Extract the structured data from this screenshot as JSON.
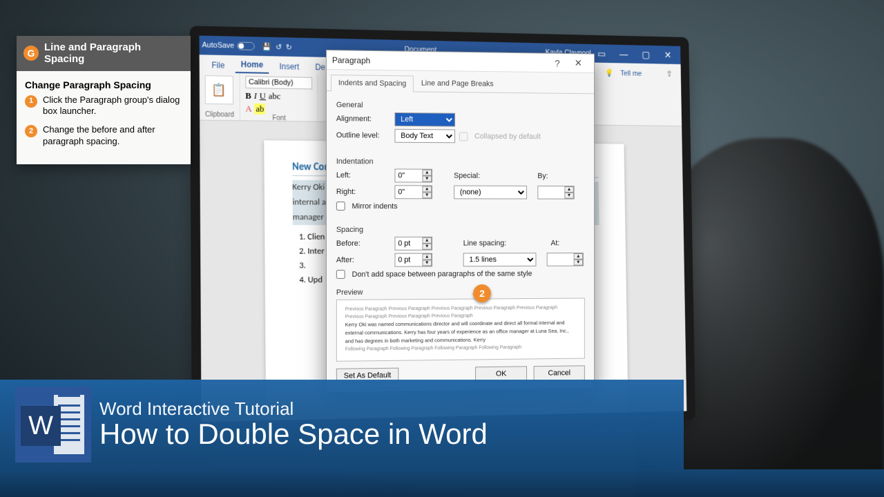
{
  "sidebar": {
    "title": "Line and Paragraph Spacing",
    "icon_letter": "G",
    "subhead": "Change Paragraph Spacing",
    "steps": [
      "Click the Paragraph group's dialog box launcher.",
      "Change the before and after paragraph spacing."
    ]
  },
  "word": {
    "autosave": "AutoSave",
    "doc_title": "Document",
    "user": "Kayla Claypool",
    "tabs": [
      "File",
      "Home",
      "Insert",
      "De"
    ],
    "active_tab": "Home",
    "tellme": "Tell me",
    "ribbon": {
      "clipboard_label": "Clipboard",
      "font_label": "Font",
      "font_name": "Calibri (Body)",
      "paste": "Paste"
    },
    "page": {
      "heading": "New Comm",
      "body": "Kerry Oki was named communications director and will coordinate and direct all formal internal and external communications. Kerry has four years of experience as an office manager at Luna Sea, Inc., and has communic",
      "list": [
        "Clien",
        "Inter",
        "",
        "Upd"
      ]
    }
  },
  "dialog": {
    "title": "Paragraph",
    "tabs": [
      "Indents and Spacing",
      "Line and Page Breaks"
    ],
    "active_tab": "Indents and Spacing",
    "general_label": "General",
    "alignment_label": "Alignment:",
    "alignment_value": "Left",
    "outline_label": "Outline level:",
    "outline_value": "Body Text",
    "collapsed_label": "Collapsed by default",
    "indent_label": "Indentation",
    "left_label": "Left:",
    "left_value": "0\"",
    "right_label": "Right:",
    "right_value": "0\"",
    "special_label": "Special:",
    "special_value": "(none)",
    "by_label": "By:",
    "mirror_label": "Mirror indents",
    "spacing_label": "Spacing",
    "before_label": "Before:",
    "before_value": "0 pt",
    "after_label": "After:",
    "after_value": "0 pt",
    "linesp_label": "Line spacing:",
    "linesp_value": "1.5 lines",
    "at_label": "At:",
    "nosame_label": "Don't add space between paragraphs of the same style",
    "preview_label": "Preview",
    "preview_text1": "Previous Paragraph Previous Paragraph Previous Paragraph Previous Paragraph Previous Paragraph Previous Paragraph Previous Paragraph Previous Paragraph",
    "preview_text2": "Kerry Oki was named communications director and will coordinate and direct all formal internal and external communications. Kerry has four years of experience as an office manager at Luna Sea, Inc., and has degrees in both marketing and communications. Kerry",
    "preview_text3": "Following Paragraph Following Paragraph Following Paragraph Following Paragraph",
    "btn_setdefault": "Set As Default",
    "btn_ok": "OK",
    "btn_cancel": "Cancel"
  },
  "callout": {
    "num": "2"
  },
  "band": {
    "line1": "Word Interactive Tutorial",
    "line2": "How to Double Space in Word",
    "icon_letter": "W"
  }
}
